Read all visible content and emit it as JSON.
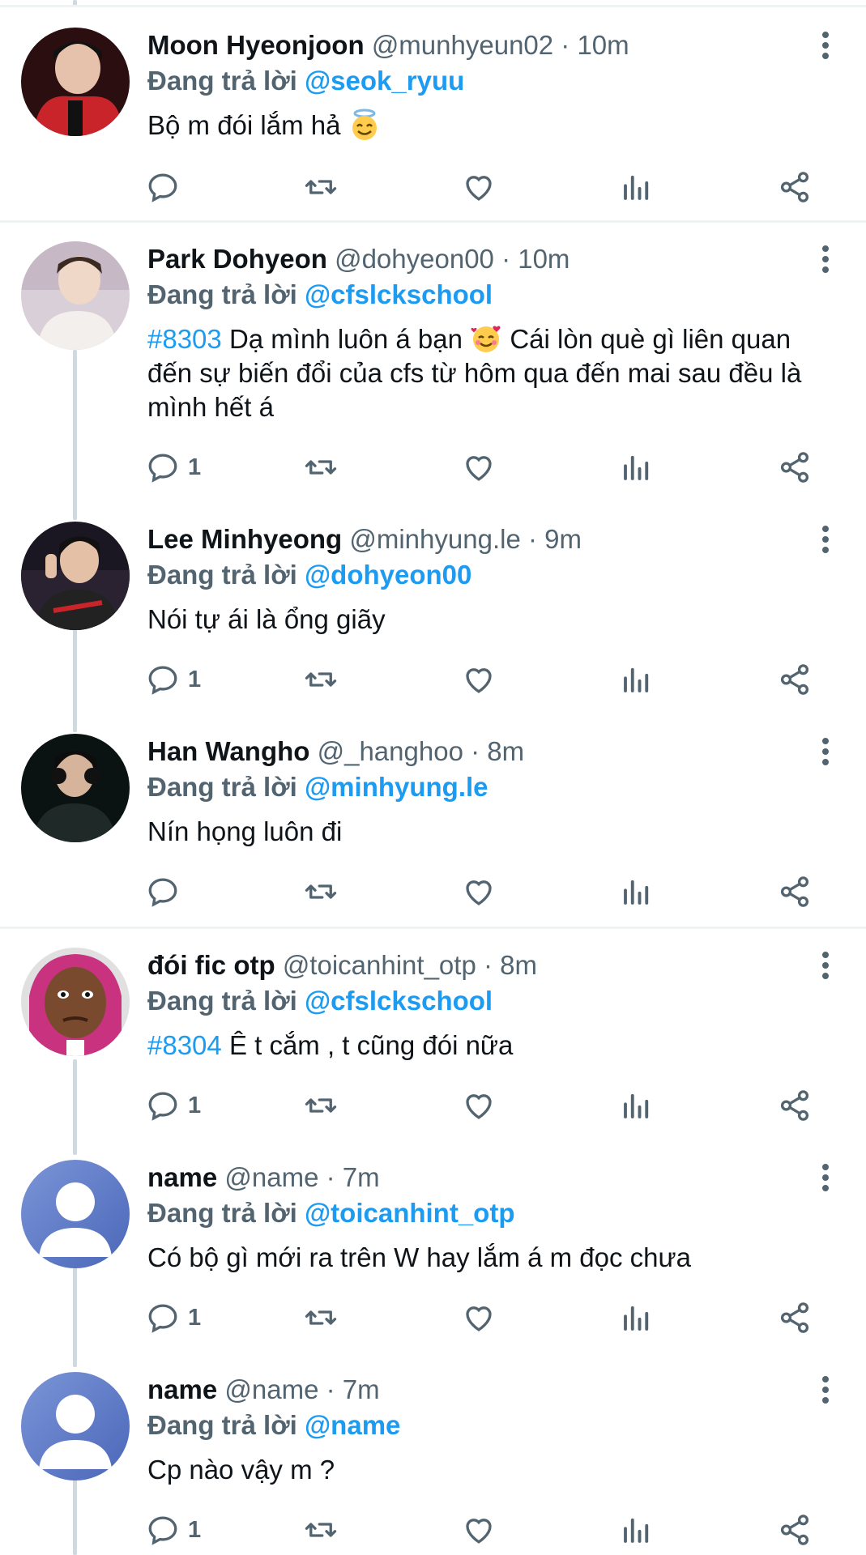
{
  "reply_prefix": "Đang trả lời",
  "tweets": [
    {
      "name": "Moon Hyeonjoon",
      "handle": "@munhyeun02 · 10m",
      "reply_to": "@seok_ryuu",
      "hashtag": "",
      "text": "Bộ m đói lắm hả",
      "emoji": "halo-face-icon",
      "reply_count": "",
      "avatar_colors": [
        "#2b0e10",
        "#c8242a"
      ]
    },
    {
      "name": "Park Dohyeon",
      "handle": "@dohyeon00 · 10m",
      "reply_to": "@cfslckschool",
      "hashtag": "#8303",
      "text": "Dạ mình luôn á bạn",
      "emoji": "smiling-hearts-icon",
      "text_after": "Cái lòn què gì liên quan đến sự biến đổi của cfs từ hôm qua đến mai sau đều là mình hết á",
      "reply_count": "1",
      "avatar_colors": [
        "#d9cfd8",
        "#f0ece9"
      ]
    },
    {
      "name": "Lee Minhyeong",
      "handle": "@minhyung.le · 9m",
      "reply_to": "@dohyeon00",
      "hashtag": "",
      "text": "Nói tự ái là ổng giãy",
      "reply_count": "1",
      "avatar_colors": [
        "#1a1622",
        "#3a2d3c"
      ]
    },
    {
      "name": "Han Wangho",
      "handle": "@_hanghoo · 8m",
      "reply_to": "@minhyung.le",
      "hashtag": "",
      "text": "Nín họng luôn đi",
      "reply_count": "",
      "avatar_colors": [
        "#0b1212",
        "#1f2a28"
      ]
    },
    {
      "name": "đói fic otp",
      "handle": "@toicanhint_otp · 8m",
      "reply_to": "@cfslckschool",
      "hashtag": "#8304",
      "text": "Ê t cắm , t cũng đói nữa",
      "reply_count": "1",
      "avatar_colors": [
        "#c8327e",
        "#7a4a2e"
      ]
    },
    {
      "name": "name",
      "handle": "@name · 7m",
      "reply_to": "@toicanhint_otp",
      "hashtag": "",
      "text": "Có bộ gì mới ra trên W hay lắm á m đọc chưa",
      "reply_count": "1",
      "avatar_colors": [
        "#5b79c6",
        "#7c95d8"
      ]
    },
    {
      "name": "name",
      "handle": "@name · 7m",
      "reply_to": "@name",
      "hashtag": "",
      "text": "Cp nào vậy m ?",
      "reply_count": "1",
      "avatar_colors": [
        "#5b79c6",
        "#7c95d8"
      ]
    }
  ],
  "colors": {
    "link": "#1d9bf0",
    "muted": "#536471",
    "thread_line": "#cfd9de"
  },
  "icons": [
    "reply-icon",
    "retweet-icon",
    "like-icon",
    "views-icon",
    "share-icon",
    "more-vertical-icon"
  ]
}
